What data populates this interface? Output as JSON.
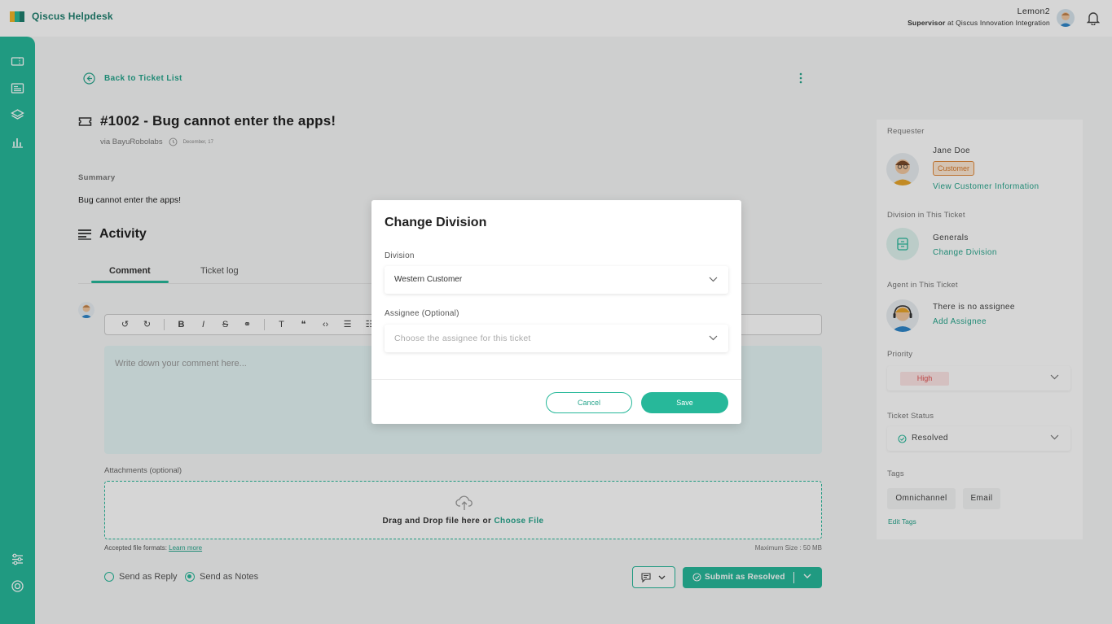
{
  "app": {
    "name": "Qiscus Helpdesk"
  },
  "user": {
    "name": "Lemon2",
    "role": "Supervisor",
    "org_prefix": "at",
    "org": "Qiscus Innovation Integration"
  },
  "ticket": {
    "back_label": "Back to Ticket List",
    "title": "#1002 - Bug cannot enter the apps!",
    "via": "via BayuRobolabs",
    "date": "December, 17",
    "summary_label": "Summary",
    "summary_text": "Bug cannot enter the apps!"
  },
  "activity": {
    "title": "Activity",
    "tabs": [
      "Comment",
      "Ticket log"
    ],
    "editor_placeholder": "Write down your comment here...",
    "attachments_label": "Attachments (optional)",
    "drop_text": "Drag and Drop file here or",
    "choose_file": "Choose File",
    "formats_label": "Accepted file formats:",
    "learn_more": "Learn more",
    "max_size": "Maximum Size : 50 MB",
    "send_reply": "Send as Reply",
    "send_notes": "Send as Notes",
    "submit_label": "Submit as Resolved"
  },
  "panel": {
    "requester_label": "Requester",
    "requester_name": "Jane Doe",
    "customer_badge": "Customer",
    "view_customer": "View Customer Information",
    "division_label": "Division in This Ticket",
    "division_name": "Generals",
    "change_division": "Change Division",
    "agent_label": "Agent in This Ticket",
    "no_assignee": "There is no assignee",
    "add_assignee": "Add Assignee",
    "priority_label": "Priority",
    "priority_value": "High",
    "status_label": "Ticket Status",
    "status_value": "Resolved",
    "tags_label": "Tags",
    "tags": [
      "Omnichannel",
      "Email"
    ],
    "edit_tags": "Edit Tags"
  },
  "modal": {
    "title": "Change Division",
    "division_label": "Division",
    "division_value": "Western Customer",
    "assignee_label": "Assignee (Optional)",
    "assignee_placeholder": "Choose the assignee for this ticket",
    "cancel": "Cancel",
    "save": "Save"
  },
  "colors": {
    "accent": "#27b89a",
    "accent_text": "#27a58c",
    "priority": "#e05050",
    "customer": "#d87a2a"
  },
  "icons": [
    "ticket-icon",
    "contacts-icon",
    "layers-icon",
    "analytics-icon",
    "settings-sliders-icon",
    "help-icon",
    "bell-icon",
    "back-arrow-icon",
    "kebab-icon",
    "upload-icon",
    "note-icon",
    "check-circle-icon",
    "chevron-down-icon"
  ]
}
